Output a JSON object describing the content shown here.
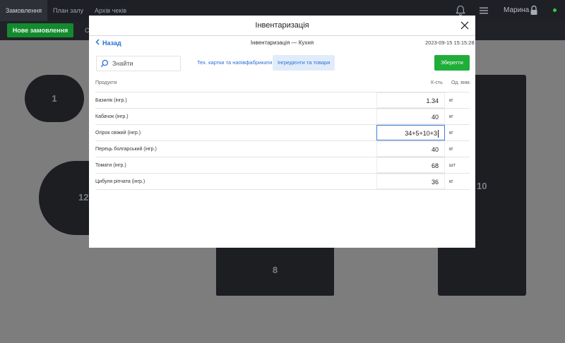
{
  "topbar": {
    "tabs": [
      "Замовлення",
      "План залу",
      "Архів чеків"
    ],
    "user": "Марина",
    "icons": [
      "bell-icon",
      "menu-icon",
      "lock-icon"
    ]
  },
  "subbar": {
    "new_order": "Нове замовлення",
    "partial_label": "С"
  },
  "floor": {
    "tables": [
      "1",
      "12",
      "10",
      "8"
    ]
  },
  "modal": {
    "title": "Інвентаризація",
    "back_label": "Назад",
    "subtitle": "Інвентаризація — Кухня",
    "datetime": "2023-09-15 15:15:28",
    "search_placeholder": "Знайти",
    "filters": [
      "Тех. картки та напівфабрикати",
      "Інгредієнти та товари"
    ],
    "save_label": "Зберегти",
    "columns": {
      "product": "Продукти",
      "qty": "К-сть",
      "unit": "Од. вим."
    },
    "rows": [
      {
        "name": "Базилік (інгр.)",
        "qty": "1.34",
        "unit": "кг"
      },
      {
        "name": "Кабачок (інгр.)",
        "qty": "40",
        "unit": "кг"
      },
      {
        "name": "Огірок свіжий (інгр.)",
        "qty": "34+5+10+3",
        "unit": "кг"
      },
      {
        "name": "Перець болгарський (інгр.)",
        "qty": "40",
        "unit": "кг"
      },
      {
        "name": "Томати (інгр.)",
        "qty": "68",
        "unit": "шт"
      },
      {
        "name": "Цибуля ріпчата (інгр.)",
        "qty": "36",
        "unit": "кг"
      }
    ]
  },
  "colors": {
    "accent": "#2b6fd6",
    "save": "#1fae39",
    "new_order": "#138a2e",
    "online": "#2ecc40"
  }
}
